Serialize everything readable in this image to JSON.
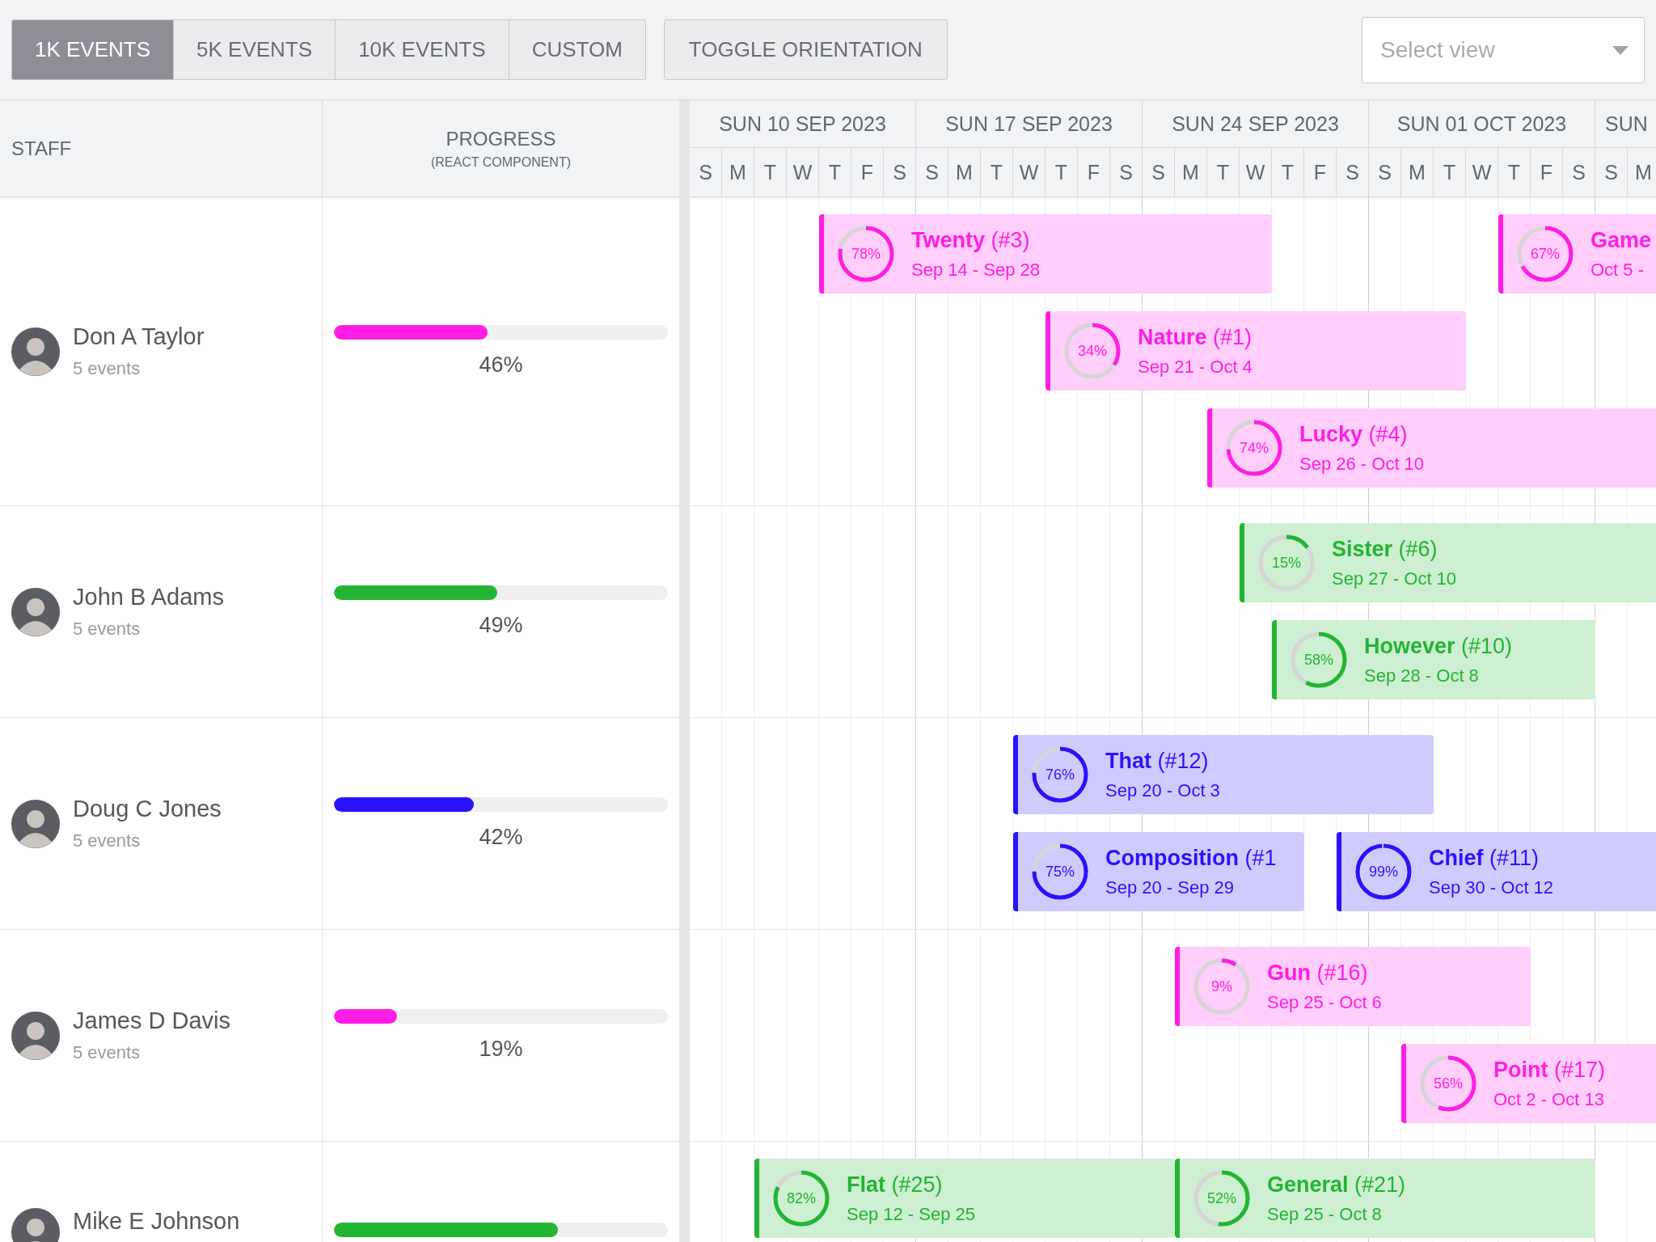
{
  "toolbar": {
    "tabs": [
      {
        "label": "1K EVENTS",
        "selected": true
      },
      {
        "label": "5K EVENTS",
        "selected": false
      },
      {
        "label": "10K EVENTS",
        "selected": false
      },
      {
        "label": "CUSTOM",
        "selected": false
      }
    ],
    "toggle_button": "TOGGLE ORIENTATION",
    "view_select": {
      "placeholder": "Select view"
    }
  },
  "columns": {
    "staff": "STAFF",
    "progress": "PROGRESS",
    "progress_note": "(REACT COMPONENT)"
  },
  "timeline": {
    "weeks": [
      "SUN 10 SEP 2023",
      "SUN 17 SEP 2023",
      "SUN 24 SEP 2023",
      "SUN 01 OCT 2023",
      "SUN"
    ],
    "days": [
      "S",
      "M",
      "T",
      "W",
      "T",
      "F",
      "S",
      "S",
      "M",
      "T",
      "W",
      "T",
      "F",
      "S",
      "S",
      "M",
      "T",
      "W",
      "T",
      "F",
      "S",
      "S",
      "M",
      "T",
      "W",
      "T",
      "F",
      "S",
      "S",
      "M"
    ]
  },
  "staff": [
    {
      "name": "Don A Taylor",
      "subtitle": "5 events",
      "level": 0.46,
      "reading": "46%",
      "color": "#ff1ee6",
      "events": [
        {
          "title": "**Twenty** (#3)",
          "dates": "Sep 14 - Sep 28",
          "pct": "78%",
          "level": 0.78
        },
        {
          "title": "**Game**",
          "dates": "Oct 5 -",
          "pct": "67%",
          "level": 0.67
        },
        {
          "title": "**Nature** (#1)",
          "dates": "Sep 21 - Oct 4",
          "pct": "34%",
          "level": 0.34
        },
        {
          "title": "**Lucky** (#4)",
          "dates": "Sep 26 - Oct 10",
          "pct": "74%",
          "level": 0.74
        }
      ]
    },
    {
      "name": "John B Adams",
      "subtitle": "5 events",
      "level": 0.49,
      "reading": "49%",
      "color": "#22b532",
      "events": [
        {
          "title": "**Sister** (#6)",
          "dates": "Sep 27 - Oct 10",
          "pct": "15%",
          "level": 0.15
        },
        {
          "title": "**However** (#10)",
          "dates": "Sep 28 - Oct 8",
          "pct": "58%",
          "level": 0.58
        }
      ]
    },
    {
      "name": "Doug C Jones",
      "subtitle": "5 events",
      "level": 0.42,
      "reading": "42%",
      "color": "#2a12ff",
      "events": [
        {
          "title": "**That** (#12)",
          "dates": "Sep 20 - Oct 3",
          "pct": "76%",
          "level": 0.76
        },
        {
          "title": "**Composition** (#1",
          "dates": "Sep 20 - Sep 29",
          "pct": "75%",
          "level": 0.75
        },
        {
          "title": "**Chief** (#11)",
          "dates": "Sep 30 - Oct 12",
          "pct": "99%",
          "level": 0.99
        }
      ]
    },
    {
      "name": "James D Davis",
      "subtitle": "5 events",
      "level": 0.19,
      "reading": "19%",
      "color": "#ff1ee6",
      "events": [
        {
          "title": "**Gun** (#16)",
          "dates": "Sep 25 - Oct 6",
          "pct": "9%",
          "level": 0.09
        },
        {
          "title": "**Point** (#17)",
          "dates": "Oct 2 - Oct 13",
          "pct": "56%",
          "level": 0.56
        }
      ]
    },
    {
      "name": "Mike E Johnson",
      "level": 0.67,
      "color": "#22b532",
      "events": [
        {
          "title": "**Flat** (#25)",
          "dates": "Sep 12 - Sep 25",
          "pct": "82%",
          "level": 0.82
        },
        {
          "title": "**General** (#21)",
          "dates": "Sep 25 - Oct 8",
          "pct": "52%",
          "level": 0.52
        }
      ]
    }
  ]
}
